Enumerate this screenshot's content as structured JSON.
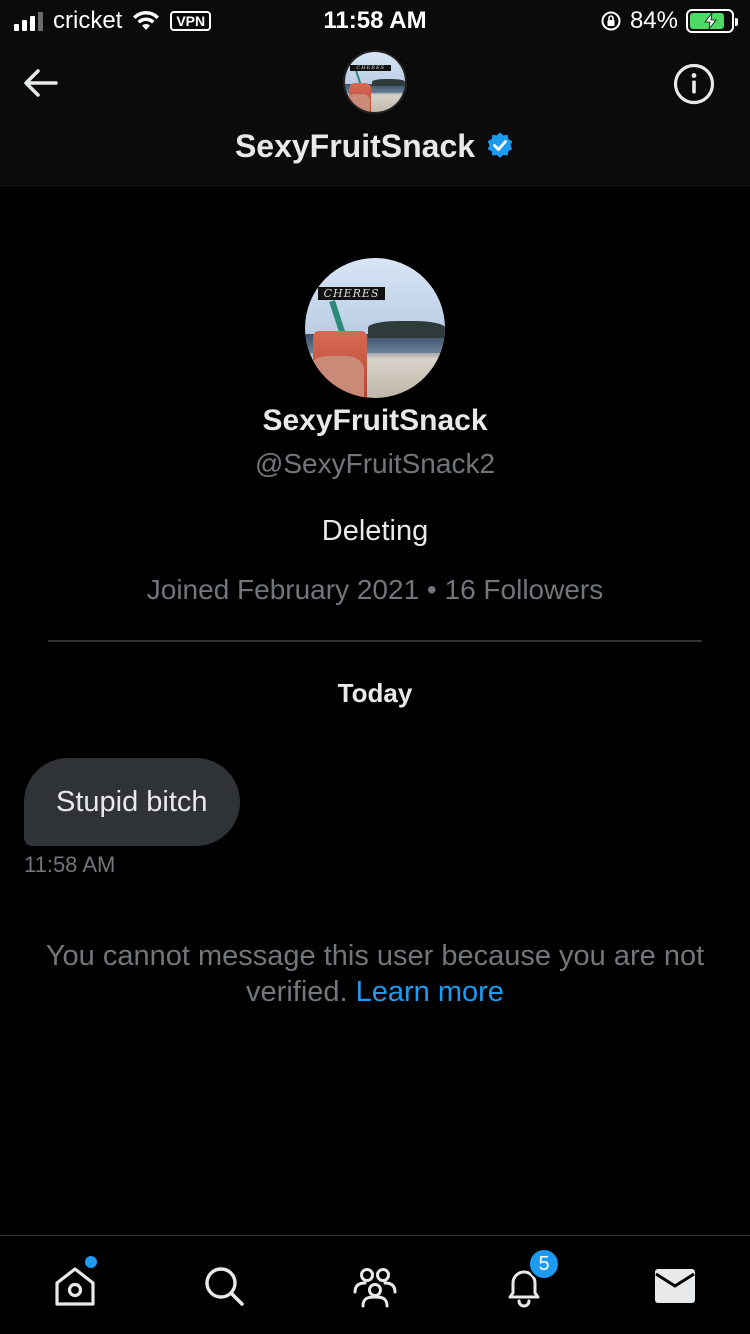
{
  "status_bar": {
    "carrier": "cricket",
    "vpn": "VPN",
    "time": "11:58 AM",
    "battery": "84%",
    "battery_level": 0.84
  },
  "header": {
    "name": "SexyFruitSnack",
    "avatar_text": "CHERES"
  },
  "profile": {
    "name": "SexyFruitSnack",
    "handle": "@SexyFruitSnack2",
    "bio": "Deleting",
    "meta": "Joined February 2021 • 16 Followers"
  },
  "conversation": {
    "day_label": "Today",
    "messages": [
      {
        "text": "Stupid bitch",
        "time": "11:58 AM"
      }
    ]
  },
  "notice": {
    "text": "You cannot message this user because you are not verified.",
    "link": "Learn more"
  },
  "tabbar": {
    "notifications_badge": "5"
  },
  "colors": {
    "accent": "#1d9bf0",
    "bubble": "#2f3336",
    "muted": "#71767b",
    "battery_fill": "#4cd964"
  },
  "icons": {
    "back": "arrow-left-icon",
    "info": "info-icon",
    "verified": "verified-badge-icon",
    "home": "home-icon",
    "search": "search-icon",
    "communities": "communities-icon",
    "notifications": "bell-icon",
    "messages": "mail-icon"
  }
}
